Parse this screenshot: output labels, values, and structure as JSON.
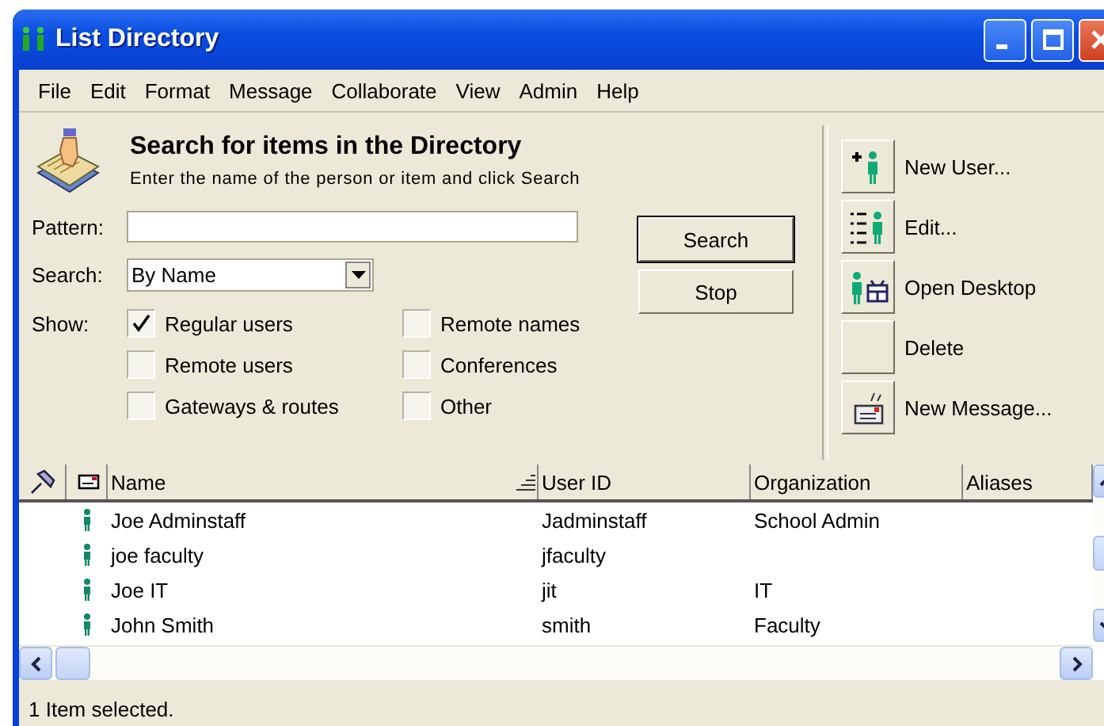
{
  "window": {
    "title": "List Directory"
  },
  "menu": [
    "File",
    "Edit",
    "Format",
    "Message",
    "Collaborate",
    "View",
    "Admin",
    "Help"
  ],
  "search_panel": {
    "title": "Search for items in the Directory",
    "subtitle": "Enter the name of the person or item and click Search",
    "pattern_label": "Pattern:",
    "search_label": "Search:",
    "search_by": "By Name",
    "show_label": "Show:",
    "filters": [
      {
        "label": "Regular users",
        "checked": true
      },
      {
        "label": "Remote users",
        "checked": false
      },
      {
        "label": "Gateways & routes",
        "checked": false
      },
      {
        "label": "Remote names",
        "checked": false
      },
      {
        "label": "Conferences",
        "checked": false
      },
      {
        "label": "Other",
        "checked": false
      }
    ],
    "buttons": [
      {
        "label": "Search",
        "default": true
      },
      {
        "label": "Stop",
        "default": false
      }
    ]
  },
  "actions": [
    {
      "label": "New User...",
      "kind": "new_user"
    },
    {
      "label": "Edit...",
      "kind": "edit"
    },
    {
      "label": "Open Desktop",
      "kind": "open_desktop"
    },
    {
      "label": "Delete",
      "kind": "blank"
    },
    {
      "label": "New Message...",
      "kind": "new_message"
    }
  ],
  "table": {
    "columns": [
      "Name",
      "User ID",
      "Organization",
      "Aliases"
    ],
    "rows": [
      {
        "name": "Joe Adminstaff",
        "user_id": "Jadminstaff",
        "organization": "School Admin"
      },
      {
        "name": "joe faculty",
        "user_id": "jfaculty",
        "organization": ""
      },
      {
        "name": "Joe IT",
        "user_id": "jit",
        "organization": "IT"
      },
      {
        "name": "John Smith",
        "user_id": "smith",
        "organization": "Faculty"
      }
    ]
  },
  "status_bar": "1 Item selected."
}
